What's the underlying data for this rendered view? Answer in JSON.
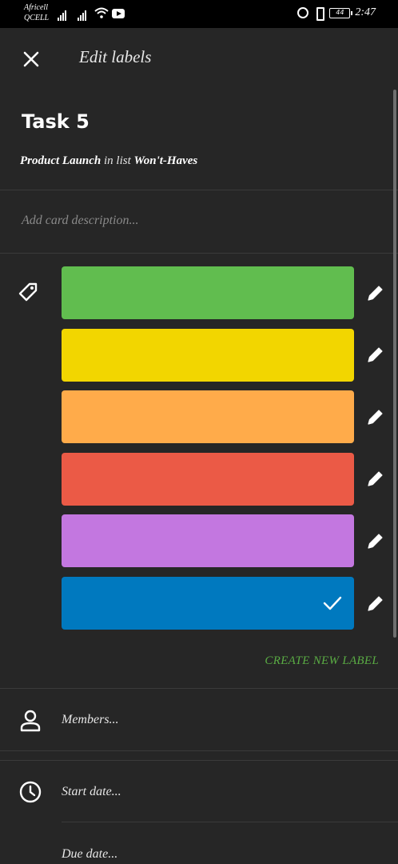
{
  "status_bar": {
    "carrier_line1": "Africell",
    "carrier_line2": "QCELL",
    "battery": "44",
    "time": "2:47"
  },
  "header": {
    "title": "Edit labels",
    "close_icon": "close-icon"
  },
  "card": {
    "title": "Task 5",
    "board": "Product Launch",
    "in_list_text": "in list",
    "list": "Won't-Haves",
    "description_placeholder": "Add card description..."
  },
  "labels": {
    "icon": "tag-icon",
    "items": [
      {
        "color": "#61bd4f",
        "selected": false
      },
      {
        "color": "#f2d600",
        "selected": false
      },
      {
        "color": "#ffab4a",
        "selected": false
      },
      {
        "color": "#eb5a46",
        "selected": false
      },
      {
        "color": "#c377e0",
        "selected": false
      },
      {
        "color": "#0079bf",
        "selected": true
      }
    ],
    "create_new_label": "CREATE NEW LABEL",
    "accent_color": "#5aac44"
  },
  "rows": {
    "members": "Members...",
    "start_date": "Start date...",
    "due_date": "Due date..."
  }
}
